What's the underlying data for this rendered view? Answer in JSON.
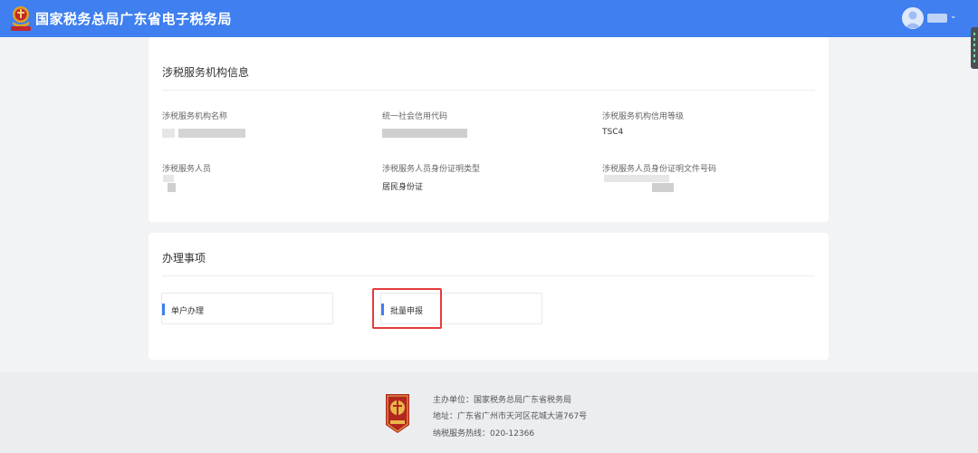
{
  "header": {
    "site_title": "国家税务总局广东省电子税务局",
    "emblem_icon": "tax-bureau-emblem-icon",
    "user_caret": "⌄",
    "brand_color": "#3f7fef"
  },
  "info_card": {
    "title": "涉税服务机构信息",
    "fields": [
      {
        "label": "涉税服务机构名称",
        "value": ""
      },
      {
        "label": "统一社会信用代码",
        "value": ""
      },
      {
        "label": "涉税服务机构信用等级",
        "value": "TSC4"
      },
      {
        "label": "涉税服务人员",
        "value": ""
      },
      {
        "label": "涉税服务人员身份证明类型",
        "value": "居民身份证"
      },
      {
        "label": "涉税服务人员身份证明文件号码",
        "value": ""
      }
    ]
  },
  "tasks_card": {
    "title": "办理事项",
    "items": [
      {
        "label": "单户办理"
      },
      {
        "label": "批量申报"
      }
    ],
    "highlight_color": "#e63b3b"
  },
  "footer": {
    "host": "主办单位：国家税务总局广东省税务局",
    "address": "地址：广东省广州市天河区花城大道767号",
    "hotline": "纳税服务热线：020-12366",
    "emblem_icon": "customs-emblem-icon"
  }
}
